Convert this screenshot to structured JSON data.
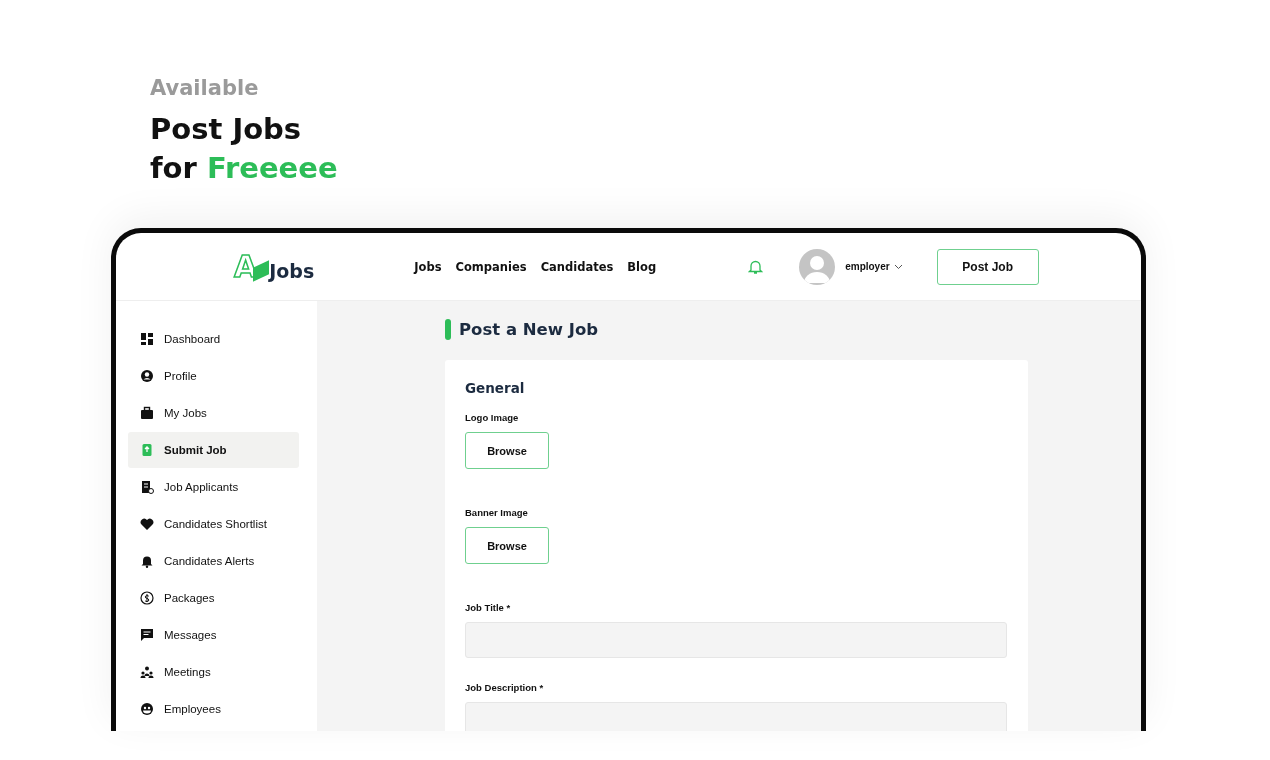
{
  "headline": {
    "eyebrow": "Available",
    "line1": "Post Jobs",
    "line2_prefix": "for",
    "line2_accent": "Freeeee"
  },
  "header": {
    "logo_letter": "A",
    "logo_text": "Jobs",
    "nav": [
      "Jobs",
      "Companies",
      "Candidates",
      "Blog"
    ],
    "user": "employer",
    "post_button": "Post Job"
  },
  "sidebar": {
    "items": [
      {
        "label": "Dashboard",
        "selected": false
      },
      {
        "label": "Profile",
        "selected": false
      },
      {
        "label": "My Jobs",
        "selected": false
      },
      {
        "label": "Submit Job",
        "selected": true
      },
      {
        "label": "Job Applicants",
        "selected": false
      },
      {
        "label": "Candidates Shortlist",
        "selected": false
      },
      {
        "label": "Candidates Alerts",
        "selected": false
      },
      {
        "label": "Packages",
        "selected": false
      },
      {
        "label": "Messages",
        "selected": false
      },
      {
        "label": "Meetings",
        "selected": false
      },
      {
        "label": "Employees",
        "selected": false
      }
    ]
  },
  "page_title": "Post a New Job",
  "form": {
    "section": "General",
    "fields": [
      {
        "kind": "file",
        "label": "Logo Image",
        "button": "Browse"
      },
      {
        "kind": "file",
        "label": "Banner Image",
        "button": "Browse"
      },
      {
        "kind": "text",
        "label": "Job Title *"
      },
      {
        "kind": "text",
        "label": "Job Description *"
      }
    ]
  }
}
